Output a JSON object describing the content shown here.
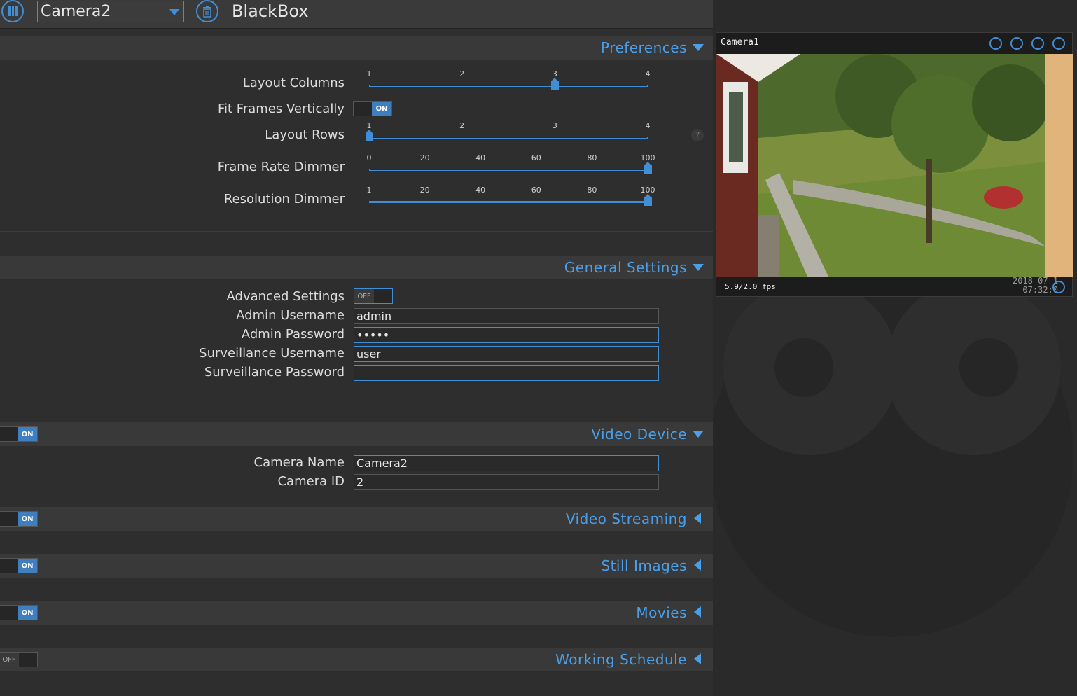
{
  "header": {
    "camera_select": "Camera2",
    "app_title": "BlackBox"
  },
  "sections": {
    "preferences": "Preferences",
    "general": "General Settings",
    "video_device": "Video Device",
    "video_streaming": "Video Streaming",
    "still_images": "Still Images",
    "movies": "Movies",
    "working_schedule": "Working Schedule"
  },
  "preferences": {
    "layout_columns": {
      "label": "Layout Columns",
      "ticks": [
        "1",
        "2",
        "3",
        "4"
      ],
      "value": 3,
      "min": 1,
      "max": 4
    },
    "fit_frames": {
      "label": "Fit Frames Vertically",
      "state": "ON"
    },
    "layout_rows": {
      "label": "Layout Rows",
      "ticks": [
        "1",
        "2",
        "3",
        "4"
      ],
      "value": 1,
      "min": 1,
      "max": 4
    },
    "frame_rate_dimmer": {
      "label": "Frame Rate Dimmer",
      "ticks": [
        "0",
        "20",
        "40",
        "60",
        "80",
        "100"
      ],
      "value": 100,
      "min": 0,
      "max": 100
    },
    "resolution_dimmer": {
      "label": "Resolution Dimmer",
      "ticks": [
        "1",
        "20",
        "40",
        "60",
        "80",
        "100"
      ],
      "value": 100,
      "min": 1,
      "max": 100
    },
    "help": "?"
  },
  "general": {
    "advanced_settings": {
      "label": "Advanced Settings",
      "state": "OFF"
    },
    "admin_username": {
      "label": "Admin Username",
      "value": "admin"
    },
    "admin_password": {
      "label": "Admin Password",
      "value": "•••••"
    },
    "surv_username": {
      "label": "Surveillance Username",
      "value": "user"
    },
    "surv_password": {
      "label": "Surveillance Password",
      "value": ""
    }
  },
  "video_device": {
    "toggle": "ON",
    "camera_name": {
      "label": "Camera Name",
      "value": "Camera2"
    },
    "camera_id": {
      "label": "Camera ID",
      "value": "2"
    }
  },
  "toggles": {
    "video_streaming": "ON",
    "still_images": "ON",
    "movies": "ON",
    "working_schedule": "OFF"
  },
  "camera_view": {
    "name": "Camera1",
    "fps": "5.9/2.0 fps",
    "date": "2018-07-1",
    "time": "07:32:0",
    "icons": [
      "fullscreen-icon",
      "picture-icon",
      "play-icon",
      "wrench-icon"
    ]
  },
  "colors": {
    "accent": "#3f8ed6",
    "background": "#2e2e2e",
    "header": "#393939"
  }
}
